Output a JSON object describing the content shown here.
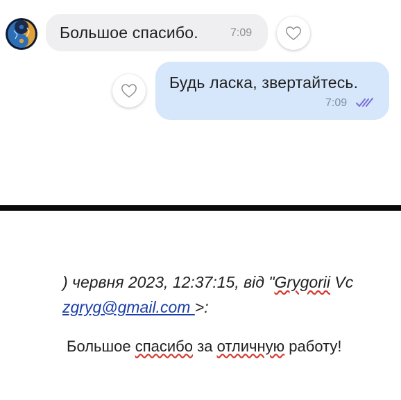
{
  "chat": {
    "incoming": {
      "text": "Большое спасибо.",
      "time": "7:09"
    },
    "outgoing": {
      "text": "Будь ласка, звертайтесь.",
      "time": "7:09",
      "status_icon": "double-check-read-icon"
    },
    "like_icon": "heart-outline-icon",
    "colors": {
      "incoming_bubble": "#efeff2",
      "outgoing_bubble": "#d6e6fb",
      "read_check": "#7a6fd8"
    }
  },
  "email": {
    "quote_prefix": ") червня 2023, 12:37:15, від \"",
    "quote_name_underlined": "Grygorii",
    "quote_name_rest": " Vc",
    "quote_name_partial_underlined": "",
    "email_address": "zgryg@gmail.com ",
    "email_suffix": ">:",
    "body_w1": "Большое ",
    "body_w2": "спасибо",
    "body_w3": " за ",
    "body_w4": "отличную",
    "body_w5": " работу!",
    "colors": {
      "link": "#1a3ea8",
      "spellcheck": "#d23b2f"
    }
  }
}
